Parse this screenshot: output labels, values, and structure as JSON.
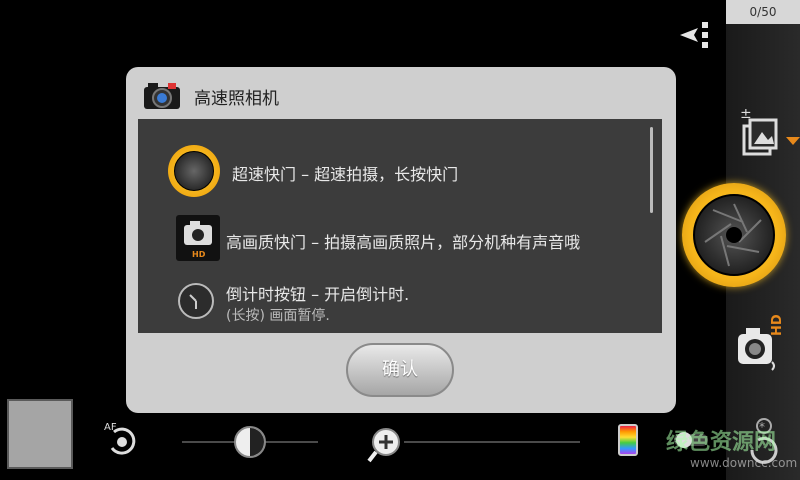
{
  "counter": "0/50",
  "dialog": {
    "title": "高速照相机",
    "confirm_label": "确认",
    "rows": [
      {
        "icon": "shutter-icon",
        "text": "超速快门 – 超速拍摄，长按快门",
        "sub": ""
      },
      {
        "icon": "hd-camera-icon",
        "text": "高画质快门 – 拍摄高画质照片，部分机种有声音哦",
        "sub": ""
      },
      {
        "icon": "timer-icon",
        "text": "倒计时按钮 – 开启倒计时.",
        "sub": "(长按) 画面暂停."
      }
    ]
  },
  "labels": {
    "hd": "HD",
    "af": "AF"
  },
  "watermark": {
    "text": "绿色资源网",
    "url": "www.downcc.com"
  },
  "colors": {
    "accent_yellow": "#f6b51a",
    "accent_orange": "#e8891b",
    "dialog_bg": "#cfcfcf",
    "content_bg": "#3c3c3c"
  }
}
